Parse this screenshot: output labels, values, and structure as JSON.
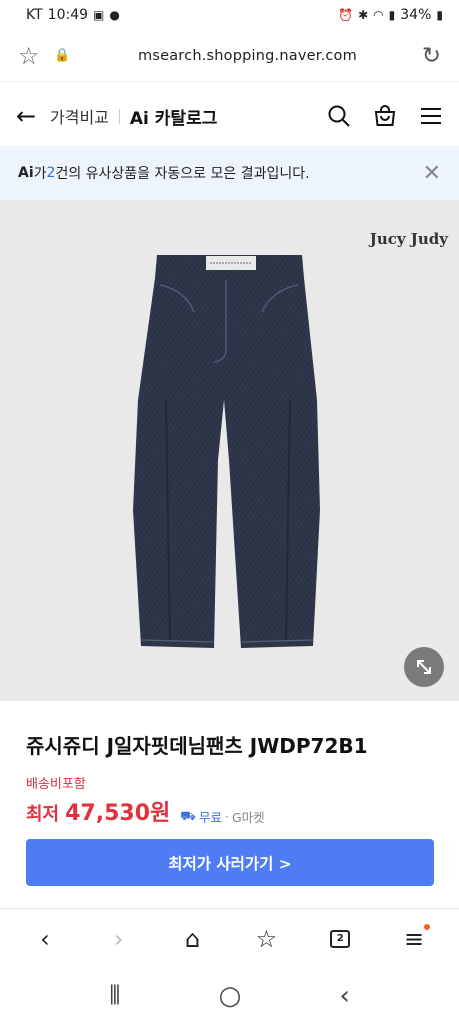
{
  "status_bar": {
    "carrier": "KT",
    "time": "10:49",
    "battery": "34%"
  },
  "browser": {
    "url": "msearch.shopping.naver.com"
  },
  "header": {
    "back_icon": "arrow-left-icon",
    "compare_label": "가격비교",
    "catalog_label": "Ai 카탈로그"
  },
  "ai_banner": {
    "logo": "Ai",
    "prefix": "가 ",
    "count": "2",
    "suffix": "건의 유사상품을 자동으로 모은 결과입니다."
  },
  "product": {
    "brand_mark": "Jucy Judy",
    "title": "쥬시쥬디 J일자핏데님팬츠 JWDP72B1",
    "shipping_note": "배송비포함",
    "price_label": "최저",
    "price_value": "47,530원",
    "shipping_free": "무료",
    "seller": "G마켓",
    "cta_label": "최저가 사러가기 >"
  },
  "browser_toolbar": {
    "tabs_count": "2"
  },
  "colors": {
    "accent_red": "#e0313c",
    "cta_blue": "#4e7cf2",
    "banner_bg": "#eef4fb",
    "image_bg": "#e9e9e9"
  }
}
